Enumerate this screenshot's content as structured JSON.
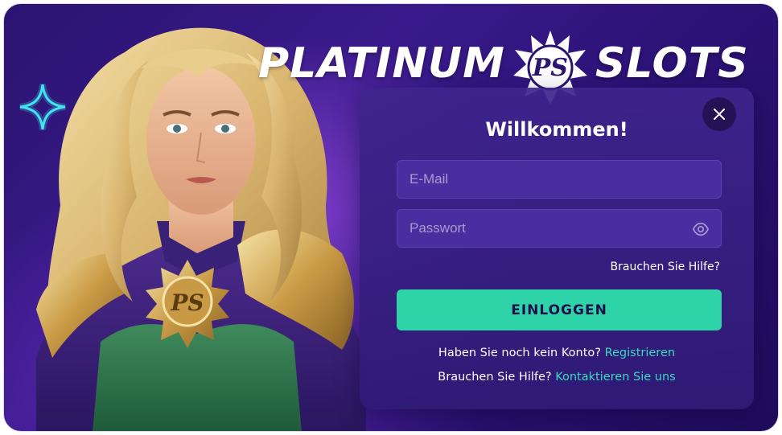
{
  "logo": {
    "word_left": "PLATINUM",
    "badge": "PS",
    "word_right": "SLOTS"
  },
  "hero": {
    "emblem": "PS"
  },
  "icons": {
    "sparkle": "sparkle-icon",
    "close": "close-icon",
    "eye": "eye-icon"
  },
  "login": {
    "title": "Willkommen!",
    "email_placeholder": "E-Mail",
    "password_placeholder": "Passwort",
    "help_link": "Brauchen Sie Hilfe?",
    "submit_label": "EINLOGGEN",
    "register_prompt": "Haben Sie noch kein Konto?",
    "register_link": "Registrieren",
    "contact_prompt": "Brauchen Sie Hilfe?",
    "contact_link": "Kontaktieren Sie uns"
  },
  "colors": {
    "background": "#2a1470",
    "panel": "#3e248c",
    "input": "#4a2d9e",
    "accent": "#2fd3a8",
    "link": "#37dcc0",
    "sparkle": "#3fe6f0"
  }
}
